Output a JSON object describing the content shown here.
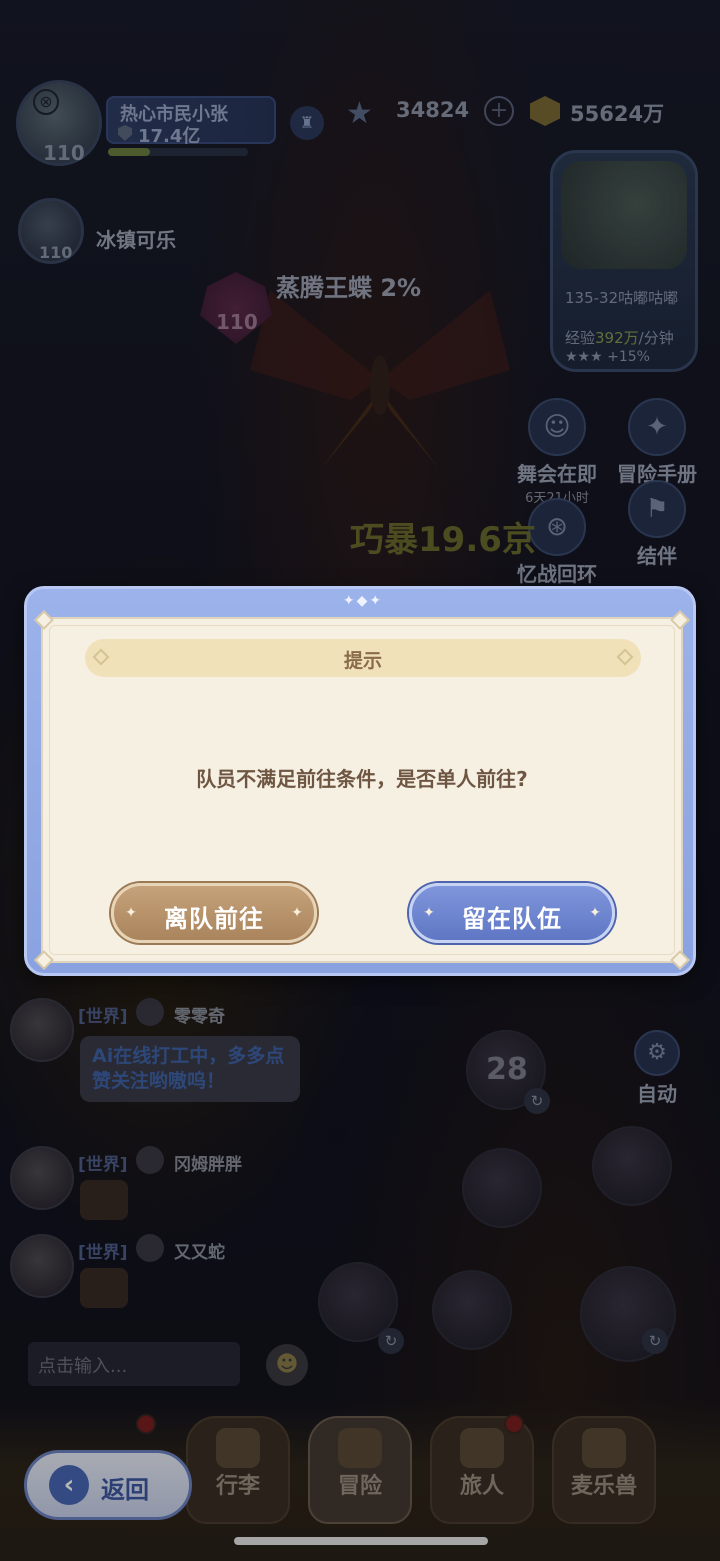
{
  "hud": {
    "player_name": "热心市民小张",
    "player_power": "17.4亿",
    "player_level": "110",
    "star_currency": "34824",
    "coin_currency": "55624万",
    "teammate_name": "冰镇可乐",
    "teammate_level": "110",
    "boss_name": "蒸腾王蝶 2%",
    "boss_level": "110",
    "crit_text": "巧暴19.6京"
  },
  "map_panel": {
    "stage": "135-32咕嘟咕嘟",
    "exp_label": "经验",
    "exp_value": "392万",
    "exp_unit": "/分钟",
    "bonus": "★★★ +15%"
  },
  "side_buttons": {
    "dance": "舞会在即",
    "dance_timer": "6天21小时",
    "adventure_book": "冒险手册",
    "memory": "忆战回环",
    "partner": "结伴",
    "auto": "自动"
  },
  "chat": {
    "messages": [
      {
        "channel": "[世界]",
        "sender": "零零奇",
        "text": "Ai在线打工中，多多点赞关注哟嗷呜！"
      },
      {
        "channel": "[世界]",
        "sender": "冈姆胖胖"
      },
      {
        "channel": "[世界]",
        "sender": "又又蛇"
      }
    ],
    "input_placeholder": "点击输入..."
  },
  "skills": {
    "timer": "28"
  },
  "bottom_nav": {
    "items": [
      "行李",
      "冒险",
      "旅人",
      "麦乐兽"
    ],
    "active": "冒险",
    "back_label": "返回"
  },
  "dialog": {
    "title": "提示",
    "message": "队员不满足前往条件，是否单人前往?",
    "leave_button": "离队前往",
    "stay_button": "留在队伍"
  },
  "colors": {
    "dialog_frame": "#9cb2ea",
    "dialog_body": "#f6f0e3",
    "leave_button": "#b8946a",
    "stay_button": "#6f87d0"
  }
}
